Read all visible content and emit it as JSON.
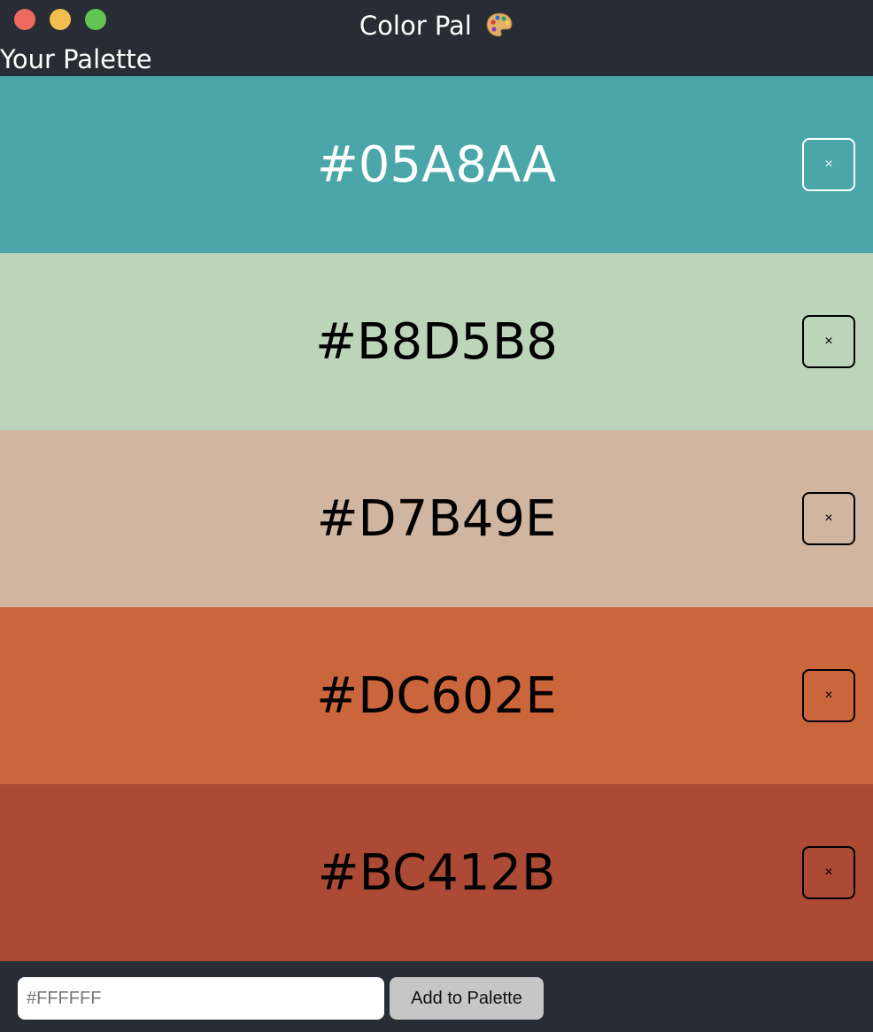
{
  "window": {
    "title": "Color Pal",
    "title_icon": "artist-palette-icon"
  },
  "heading": "Your Palette",
  "palette": [
    {
      "hex": "#05A8AA",
      "bg": "#4aa6a8",
      "text_tone": "light",
      "remove_label": "×"
    },
    {
      "hex": "#B8D5B8",
      "bg": "#bcd4ba",
      "text_tone": "dark",
      "remove_label": "×"
    },
    {
      "hex": "#D7B49E",
      "bg": "#d0b5a1",
      "text_tone": "dark",
      "remove_label": "×"
    },
    {
      "hex": "#DC602E",
      "bg": "#cb663c",
      "text_tone": "dark",
      "remove_label": "×"
    },
    {
      "hex": "#BC412B",
      "bg": "#ad4a36",
      "text_tone": "dark",
      "remove_label": "×"
    }
  ],
  "footer": {
    "input_placeholder": "#FFFFFF",
    "input_value": "",
    "add_button_label": "Add to Palette"
  }
}
